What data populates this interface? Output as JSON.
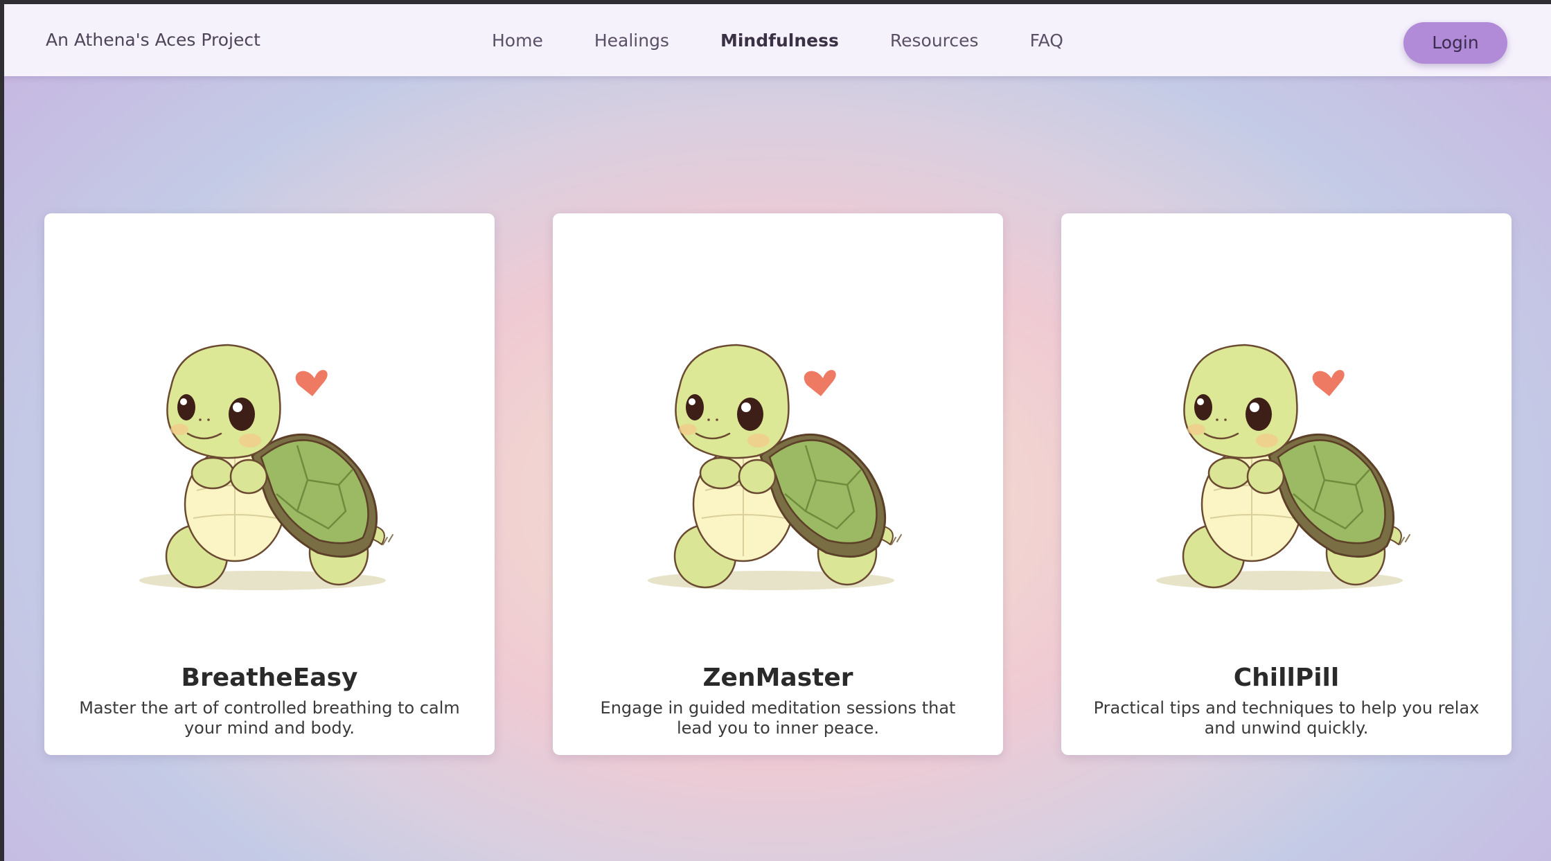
{
  "brand": "An Athena's Aces Project",
  "nav": {
    "links": [
      "Home",
      "Healings",
      "Mindfulness",
      "Resources",
      "FAQ"
    ],
    "active": "Mindfulness"
  },
  "login_label": "Login",
  "cards": [
    {
      "title": "BreatheEasy",
      "description": "Master the art of controlled breathing to calm your mind and body.",
      "image": "cute-turtle-illustration"
    },
    {
      "title": "ZenMaster",
      "description": "Engage in guided meditation sessions that lead you to inner peace.",
      "image": "cute-turtle-illustration"
    },
    {
      "title": "ChillPill",
      "description": "Practical tips and techniques to help you relax and unwind quickly.",
      "image": "cute-turtle-illustration"
    }
  ],
  "colors": {
    "accent": "#b18ad8",
    "navbar": "#f6f2fc",
    "turtle_skin": "#dde896",
    "turtle_shell": "#9cba63",
    "heart": "#ee7a63"
  }
}
